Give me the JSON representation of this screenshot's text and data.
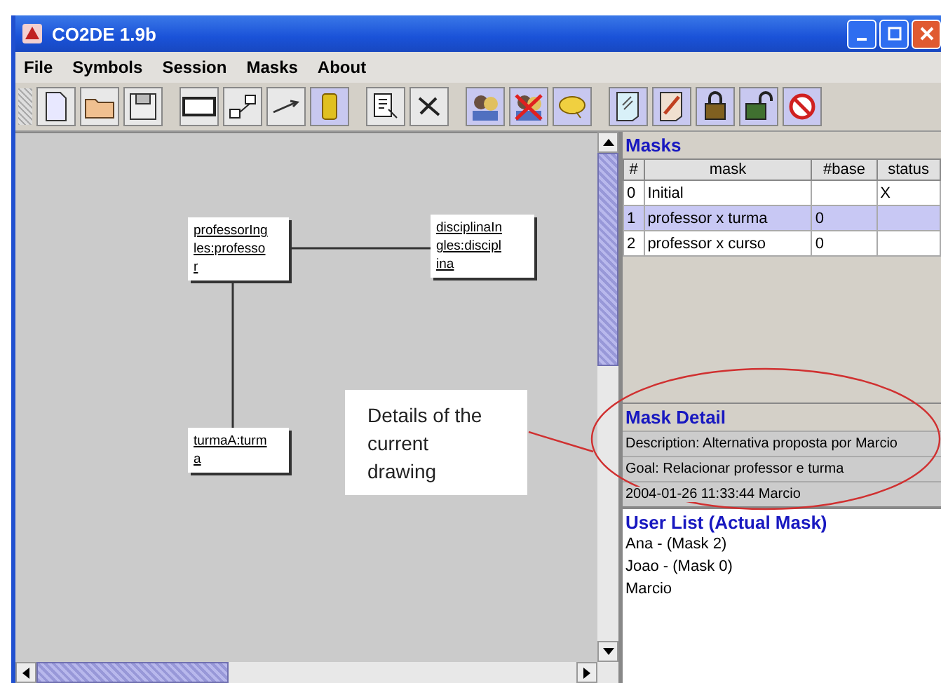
{
  "window": {
    "title": "CO2DE 1.9b"
  },
  "menu": [
    "File",
    "Symbols",
    "Session",
    "Masks",
    "About"
  ],
  "diagram": {
    "nodes": [
      {
        "lines": [
          "professorIng",
          "les:professo",
          "r"
        ]
      },
      {
        "lines": [
          "disciplinaIn",
          "gles:discipl",
          "ina"
        ]
      },
      {
        "lines": [
          "turmaA:turm",
          "a"
        ]
      }
    ],
    "callout": "Details of the current drawing"
  },
  "masks": {
    "title": "Masks",
    "columns": [
      "#",
      "mask",
      "#base",
      "status"
    ],
    "rows": [
      {
        "cells": [
          "0",
          "Initial",
          "",
          "X"
        ],
        "selected": false
      },
      {
        "cells": [
          "1",
          "professor x turma",
          "0",
          ""
        ],
        "selected": true
      },
      {
        "cells": [
          "2",
          "professor x curso",
          "0",
          ""
        ],
        "selected": false
      }
    ]
  },
  "mask_detail": {
    "title": "Mask Detail",
    "lines": [
      "Description: Alternativa proposta por Marcio",
      "Goal: Relacionar professor e turma",
      "2004-01-26 11:33:44 Marcio"
    ]
  },
  "user_list": {
    "title": "User List (Actual Mask)",
    "users": [
      "Ana - (Mask 2)",
      "Joao - (Mask 0)",
      "Marcio"
    ]
  }
}
